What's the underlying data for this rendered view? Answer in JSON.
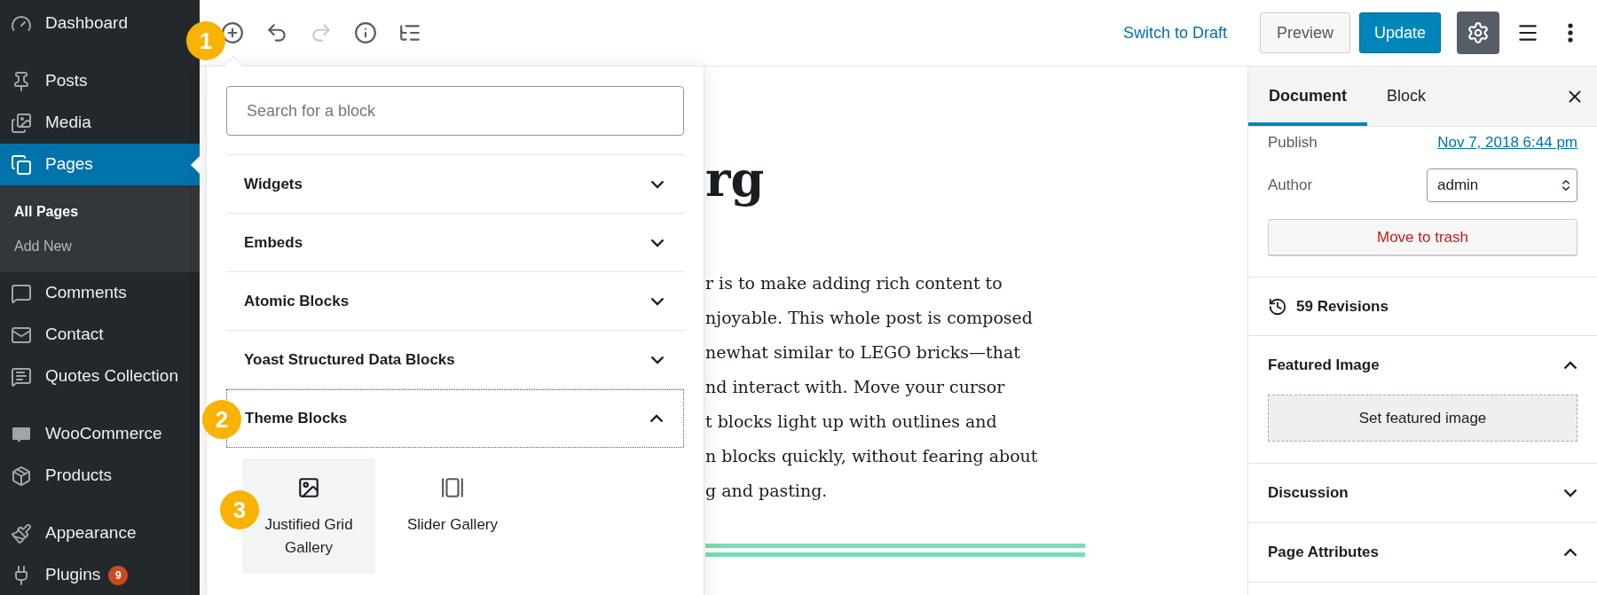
{
  "admin_menu": {
    "groups": [
      [
        {
          "label": "Dashboard",
          "selected": false
        }
      ],
      [
        {
          "label": "Posts",
          "selected": false
        },
        {
          "label": "Media",
          "selected": false
        },
        {
          "label": "Pages",
          "selected": true,
          "submenu": [
            {
              "label": "All Pages",
              "selected": true
            },
            {
              "label": "Add New",
              "selected": false
            }
          ]
        },
        {
          "label": "Comments",
          "selected": false
        },
        {
          "label": "Contact",
          "selected": false
        },
        {
          "label": "Quotes Collection",
          "selected": false
        }
      ],
      [
        {
          "label": "WooCommerce",
          "selected": false
        },
        {
          "label": "Products",
          "selected": false
        }
      ],
      [
        {
          "label": "Appearance",
          "selected": false
        },
        {
          "label": "Plugins",
          "selected": false,
          "badge": "9"
        }
      ]
    ]
  },
  "toolbar": {
    "tools": [
      {
        "kind": "inserter",
        "disabled": false
      },
      {
        "kind": "undo",
        "disabled": false
      },
      {
        "kind": "redo",
        "disabled": true
      },
      {
        "kind": "info",
        "disabled": false
      },
      {
        "kind": "outline",
        "disabled": false
      }
    ],
    "switch_to_draft": "Switch to Draft",
    "preview_button": "Preview",
    "update_button": "Update",
    "settings_toggle": {
      "pressed": true
    }
  },
  "inserter": {
    "search": {
      "placeholder": "Search for a block"
    },
    "categories": [
      {
        "label": "Widgets",
        "expanded": false,
        "focused": false
      },
      {
        "label": "Embeds",
        "expanded": false,
        "focused": false
      },
      {
        "label": "Atomic Blocks",
        "expanded": false,
        "focused": false
      },
      {
        "label": "Yoast Structured Data Blocks",
        "expanded": false,
        "focused": false
      },
      {
        "label": "Theme Blocks",
        "expanded": true,
        "focused": true,
        "blocks": [
          {
            "kind": "grid-gallery",
            "label": "Justified Grid Gallery",
            "hovered": true
          },
          {
            "kind": "slider",
            "label": "Slider Gallery",
            "hovered": false
          }
        ]
      }
    ]
  },
  "editor": {
    "title": "rg",
    "paragraph_lines": [
      "r is to make adding rich content to",
      "njoyable. This whole post is composed",
      "newhat similar to LEGO bricks—that",
      "nd interact with. Move your cursor",
      "t blocks light up with outlines and",
      "n blocks quickly, without fearing about",
      "g and pasting."
    ]
  },
  "settings_sidebar": {
    "tabs": [
      {
        "label": "Document",
        "selected": true
      },
      {
        "label": "Block",
        "selected": false
      }
    ],
    "publish_label": "Publish",
    "publish_date": "Nov 7, 2018 6:44 pm",
    "author_label": "Author",
    "author_value": "admin",
    "trash_button": "Move to trash",
    "revisions": "59 Revisions",
    "panels": [
      {
        "title": "Featured Image",
        "expanded": true,
        "button": "Set featured image"
      },
      {
        "title": "Discussion",
        "expanded": false
      },
      {
        "title": "Page Attributes",
        "expanded": true
      }
    ]
  },
  "callouts": [
    "1",
    "2",
    "3"
  ]
}
